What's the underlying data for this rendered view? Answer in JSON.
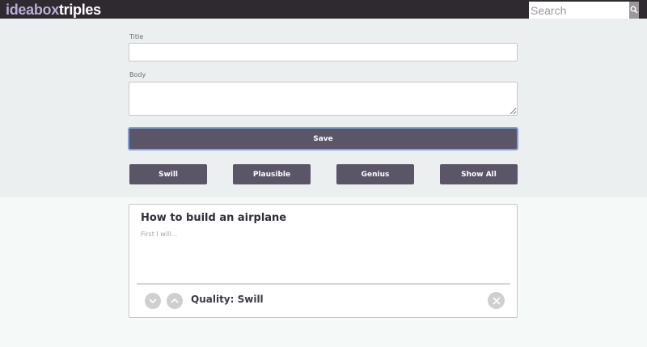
{
  "header": {
    "logo_part1": "ideabox",
    "logo_part2": "triples",
    "search_placeholder": "Search",
    "search_icon": "search-icon"
  },
  "form": {
    "title_label": "Title",
    "title_value": "",
    "body_label": "Body",
    "body_value": "",
    "save_label": "Save"
  },
  "filters": [
    {
      "label": "Swill"
    },
    {
      "label": "Plausible"
    },
    {
      "label": "Genius"
    },
    {
      "label": "Show All"
    }
  ],
  "ideas": [
    {
      "title": "How to build an airplane",
      "body": "First I will...",
      "quality_text": "Quality: Swill",
      "icons": [
        "chevron-down-icon",
        "chevron-up-icon",
        "close-icon"
      ]
    }
  ],
  "colors": {
    "header_bg": "#2f2a30",
    "logo_accent": "#b7b0d6",
    "button_bg": "#5a5567",
    "save_focus_border": "#7fa2da",
    "form_area_bg": "#ebeff0",
    "page_bg": "#f5f9f8"
  }
}
